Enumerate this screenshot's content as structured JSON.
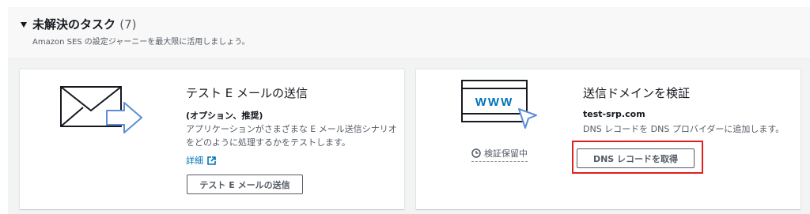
{
  "section": {
    "title": "未解決のタスク",
    "count": "(7)",
    "subtitle": "Amazon SES の設定ジャーニーを最大限に活用しましょう。"
  },
  "cards": [
    {
      "title": "テスト E メールの送信",
      "strong": "(オプション、推奨)",
      "text": "アプリケーションがさまざまな E メール送信シナリオをどのように処理するかをテストします。",
      "link_label": "詳細",
      "button_label": "テスト E メールの送信",
      "icon": "envelope-send-icon"
    },
    {
      "title": "送信ドメインを検証",
      "strong": "test-srp.com",
      "text": "DNS レコードを DNS プロバイダーに追加します。",
      "status_label": "検証保留中",
      "button_label": "DNS レコードを取得",
      "icon": "browser-www-icon"
    }
  ],
  "colors": {
    "link": "#0073bb",
    "highlight": "#e02020",
    "accent_blue": "#0073bb",
    "illustration_arrow": "#5b8dd6"
  }
}
